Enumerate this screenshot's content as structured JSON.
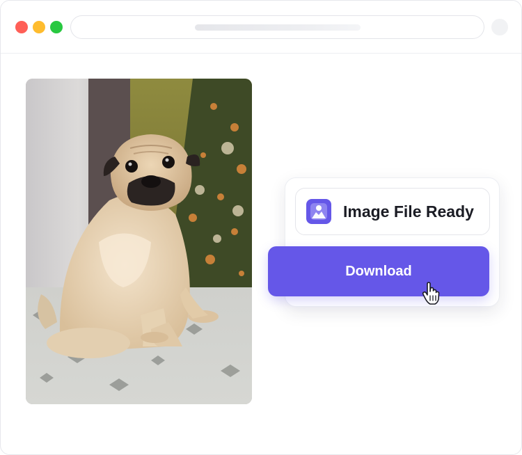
{
  "colors": {
    "accent": "#6557e8",
    "close": "#ff5f57",
    "minimize": "#febc2e",
    "zoom": "#28c840"
  },
  "browser": {
    "buttons": [
      "close",
      "minimize",
      "zoom"
    ]
  },
  "photo": {
    "subject": "pug-photo"
  },
  "file_card": {
    "icon": "image-icon",
    "title": "Image File Ready"
  },
  "download": {
    "label": "Download",
    "cursor": "hand-pointer-icon"
  }
}
